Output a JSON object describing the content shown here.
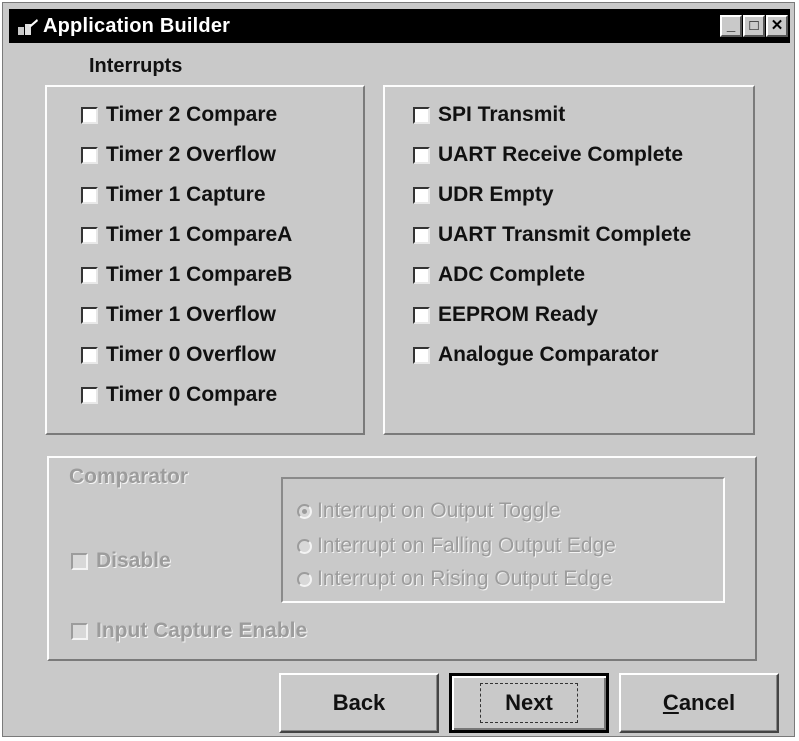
{
  "window": {
    "title": "Application Builder",
    "controls": {
      "minimize": "_",
      "maximize": "□",
      "close": "✕"
    }
  },
  "interrupts": {
    "label": "Interrupts",
    "left": [
      {
        "label": "Timer 2 Compare",
        "checked": false
      },
      {
        "label": "Timer 2 Overflow",
        "checked": false
      },
      {
        "label": "Timer 1 Capture",
        "checked": false
      },
      {
        "label": "Timer 1 CompareA",
        "checked": false
      },
      {
        "label": "Timer 1 CompareB",
        "checked": false
      },
      {
        "label": "Timer 1 Overflow",
        "checked": false
      },
      {
        "label": "Timer 0 Overflow",
        "checked": false
      },
      {
        "label": "Timer 0 Compare",
        "checked": false
      }
    ],
    "right": [
      {
        "label": "SPI Transmit",
        "checked": false
      },
      {
        "label": "UART Receive Complete",
        "checked": false
      },
      {
        "label": "UDR Empty",
        "checked": false
      },
      {
        "label": "UART Transmit Complete",
        "checked": false
      },
      {
        "label": "ADC Complete",
        "checked": false
      },
      {
        "label": "EEPROM Ready",
        "checked": false
      },
      {
        "label": "Analogue Comparator",
        "checked": false
      }
    ]
  },
  "comparator": {
    "label": "Comparator",
    "disable_label": "Disable",
    "input_capture_label": "Input Capture Enable",
    "radios": [
      {
        "label": "Interrupt on Output Toggle",
        "selected": true
      },
      {
        "label": "Interrupt on Falling Output Edge",
        "selected": false
      },
      {
        "label": "Interrupt on Rising Output Edge",
        "selected": false
      }
    ]
  },
  "buttons": {
    "back": "Back",
    "next": "Next",
    "cancel_prefix": "C",
    "cancel_rest": "ancel"
  }
}
